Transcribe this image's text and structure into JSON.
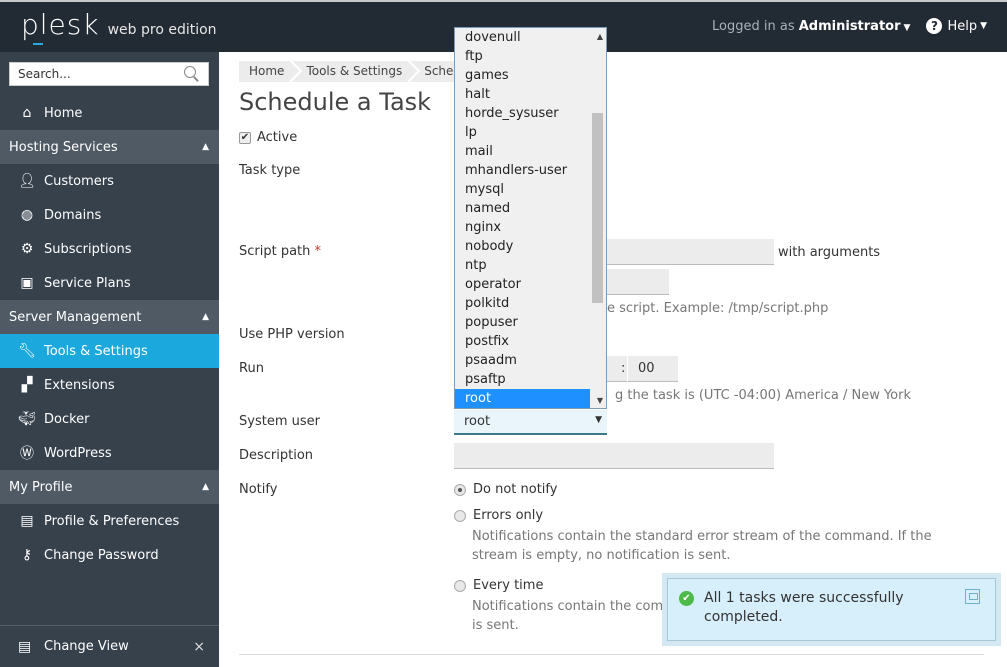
{
  "header": {
    "brand": "plesk",
    "edition": "web pro edition",
    "logged_in_label": "Logged in as",
    "user": "Administrator",
    "help": "Help"
  },
  "sidebar": {
    "search_placeholder": "Search...",
    "home": "Home",
    "groups": [
      {
        "label": "Hosting Services",
        "items": [
          "Customers",
          "Domains",
          "Subscriptions",
          "Service Plans"
        ]
      },
      {
        "label": "Server Management",
        "items": [
          "Tools & Settings",
          "Extensions",
          "Docker",
          "WordPress"
        ]
      },
      {
        "label": "My Profile",
        "items": [
          "Profile & Preferences",
          "Change Password"
        ]
      }
    ],
    "active_item": "Tools & Settings",
    "change_view": "Change View",
    "close_glyph": "×"
  },
  "breadcrumb": [
    "Home",
    "Tools & Settings",
    "Sched"
  ],
  "page_title": "Schedule a Task",
  "form": {
    "active_label": "Active",
    "active_checked": true,
    "task_type_label": "Task type",
    "script_path_label": "Script path",
    "required_mark": "*",
    "with_arguments": "with arguments",
    "script_hint_partial": "e script. Example: /tmp/script.php",
    "php_version_label": "Use PHP version",
    "run_label": "Run",
    "minute_value": "00",
    "time_separator": ":",
    "timezone_hint_partial": "g the task is (UTC -04:00) America / New York",
    "system_user_label": "System user",
    "system_user_value": "root",
    "description_label": "Description",
    "description_value": "",
    "notify_label": "Notify",
    "notify_options": [
      {
        "label": "Do not notify",
        "selected": true,
        "desc": ""
      },
      {
        "label": "Errors only",
        "selected": false,
        "desc": "Notifications contain the standard error stream of the command. If the stream is empty, no notification is sent."
      },
      {
        "label": "Every time",
        "selected": false,
        "desc_line1": "Notifications contain the comma",
        "desc_line2": "is sent."
      }
    ]
  },
  "dropdown": {
    "options": [
      "dovenull",
      "ftp",
      "games",
      "halt",
      "horde_sysuser",
      "lp",
      "mail",
      "mhandlers-user",
      "mysql",
      "named",
      "nginx",
      "nobody",
      "ntp",
      "operator",
      "polkitd",
      "popuser",
      "postfix",
      "psaadm",
      "psaftp",
      "root"
    ],
    "selected": "root"
  },
  "toast": {
    "message": "All 1 tasks were successfully completed.",
    "status_color": "#4cb948"
  }
}
